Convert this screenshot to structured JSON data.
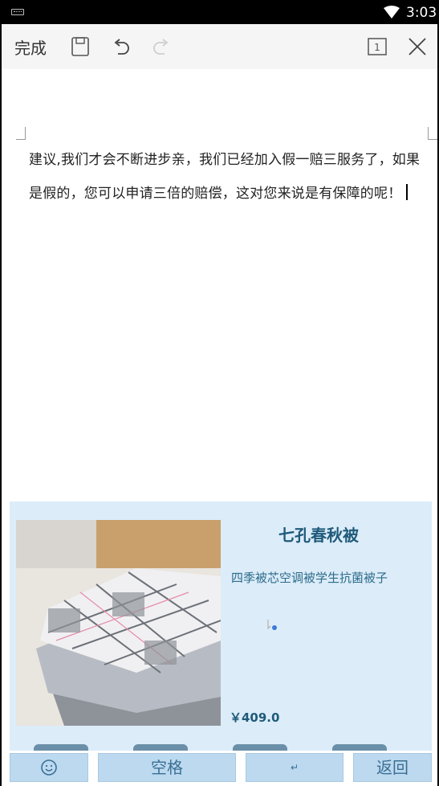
{
  "status_bar": {
    "time": "3:03"
  },
  "toolbar": {
    "done_label": "完成",
    "page_count": "1"
  },
  "document": {
    "line1": "建议,我们才会不断进步亲，我们已经加入假一赔三服务了，如果",
    "line2": "是假的，您可以申请三倍的赔偿，这对您来说是有保障的呢！"
  },
  "product": {
    "title": "七孔春秋被",
    "subtitle": "四季被芯空调被学生抗菌被子",
    "price": "￥409.0"
  },
  "keyboard": {
    "space_label": "空格",
    "enter_label": "↵",
    "back_label": "返回"
  },
  "icons": [
    "keyboard-icon",
    "wifi-icon",
    "save-icon",
    "undo-icon",
    "redo-icon",
    "page-count-icon",
    "close-icon",
    "emoji-icon",
    "cursor-icon"
  ]
}
